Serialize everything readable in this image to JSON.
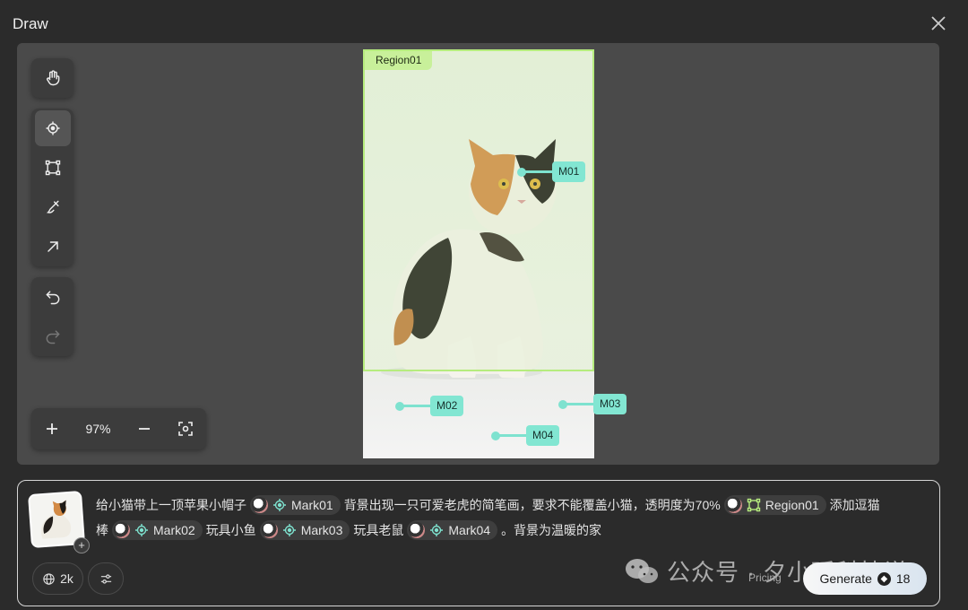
{
  "window": {
    "title": "Draw"
  },
  "zoom": {
    "value": "97%"
  },
  "canvas": {
    "region_label": "Region01",
    "marks": [
      "M01",
      "M02",
      "M03",
      "M04"
    ]
  },
  "prompt": {
    "t1": "给小猫带上一顶苹果小帽子",
    "chip_mark01": "Mark01",
    "t2": "背景出现一只可爱老虎的简笔画，要求不能覆盖小猫，透明度为70%",
    "chip_region01": "Region01",
    "t3": "添加逗猫",
    "t4": "棒",
    "chip_mark02": "Mark02",
    "t5": "玩具小鱼",
    "chip_mark03": "Mark03",
    "t6": "玩具老鼠",
    "chip_mark04": "Mark04",
    "t7": "。背景为温暖的家"
  },
  "footer": {
    "resolution": "2k",
    "pricing": "Pricing",
    "generate_label": "Generate",
    "credits": "18"
  },
  "watermark": {
    "text": "公众号 · 夕小瑶科技说"
  },
  "colors": {
    "region": "#b6ec7e",
    "mark": "#82e6d2",
    "background": "#2b2b2b",
    "canvas": "#4a4a4a"
  },
  "icons": [
    "close-icon",
    "hand-icon",
    "target-icon",
    "rect-select-icon",
    "brush-icon",
    "arrow-icon",
    "undo-icon",
    "redo-icon",
    "plus-icon",
    "minus-icon",
    "fit-screen-icon",
    "globe-icon",
    "sliders-icon",
    "wechat-icon"
  ]
}
